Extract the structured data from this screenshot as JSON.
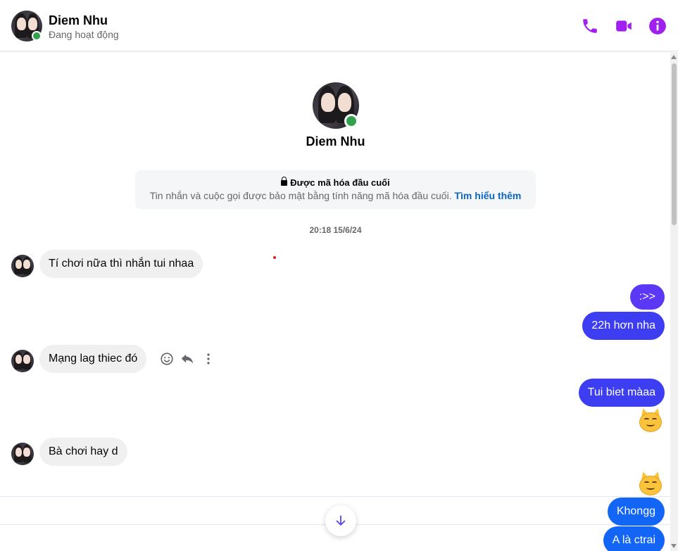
{
  "header": {
    "name": "Diem Nhu",
    "status": "Đang hoạt động",
    "icons": [
      "phone-icon",
      "video-icon",
      "info-icon"
    ]
  },
  "profile": {
    "name": "Diem Nhu"
  },
  "encryption": {
    "title": "Được mã hóa đầu cuối",
    "description": "Tin nhắn và cuộc gọi được bảo mật bằng tính năng mã hóa đầu cuối.",
    "link": "Tìm hiểu thêm"
  },
  "timestamp": "20:18 15/6/24",
  "messages": [
    {
      "direction": "in",
      "text": "Tí chơi nữa thì nhắn tui nhaa"
    },
    {
      "direction": "out",
      "text": ":>>"
    },
    {
      "direction": "out",
      "text": "22h hơn nha"
    },
    {
      "direction": "in",
      "text": "Mạng lag thiec đó"
    },
    {
      "direction": "out",
      "text": "Tui biet màaa"
    },
    {
      "direction": "out",
      "emoji": "smirking-cat"
    },
    {
      "direction": "in",
      "text": "Bà chơi hay d"
    },
    {
      "direction": "out",
      "emoji": "smirking-cat"
    },
    {
      "direction": "out",
      "text": "Khongg"
    },
    {
      "direction": "out",
      "text": "A là ctrai"
    }
  ],
  "colors": {
    "accent": "#a020f0",
    "outgoing_bubble": "#3d3df2",
    "incoming_bubble": "#f0f0f0",
    "online": "#31a24c",
    "link": "#0a66c2"
  }
}
